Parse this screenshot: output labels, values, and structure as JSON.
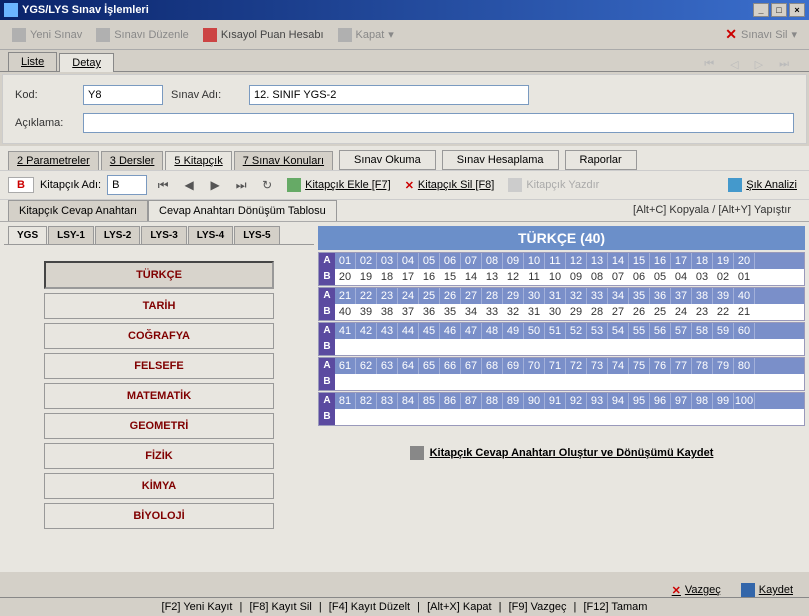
{
  "window": {
    "title": "YGS/LYS Sınav İşlemleri"
  },
  "toolbar": {
    "yeni": "Yeni Sınav",
    "duzenle": "Sınavı Düzenle",
    "kisayol": "Kısayol Puan Hesabı",
    "kapat": "Kapat",
    "sil": "Sınavı Sil"
  },
  "main_tabs": {
    "liste": "Liste",
    "detay": "Detay"
  },
  "form": {
    "kod_label": "Kod:",
    "kod_value": "Y8",
    "sinavadi_label": "Sınav Adı:",
    "sinavadi_value": "12. SINIF YGS-2",
    "aciklama_label": "Açıklama:",
    "aciklama_value": ""
  },
  "sub_tabs": {
    "parametreler": "2 Parametreler",
    "dersler": "3 Dersler",
    "kitapcik": "5 Kitapçık",
    "sinavkonulari": "7 Sınav Konuları",
    "sinavokuma": "Sınav Okuma",
    "sinavhesaplama": "Sınav Hesaplama",
    "raporlar": "Raporlar"
  },
  "kitapcik_bar": {
    "badge": "B",
    "adi_label": "Kitapçık Adı:",
    "adi_value": "B",
    "ekle": "Kitapçık Ekle [F7]",
    "sil": "Kitapçık Sil [F8]",
    "yazdir": "Kitapçık Yazdır",
    "sik": "Şık Analizi"
  },
  "cevap_tabs": {
    "anahtari": "Kitapçık Cevap Anahtarı",
    "donusum": "Cevap Anahtarı Dönüşüm Tablosu",
    "shortcut": "[Alt+C] Kopyala / [Alt+Y] Yapıştır"
  },
  "exam_tabs": [
    "YGS",
    "LSY-1",
    "LYS-2",
    "LYS-3",
    "LYS-4",
    "LYS-5"
  ],
  "subjects": [
    "TÜRKÇE",
    "TARİH",
    "COĞRAFYA",
    "FELSEFE",
    "MATEMATİK",
    "GEOMETRİ",
    "FİZİK",
    "KİMYA",
    "BİYOLOJİ"
  ],
  "active_subject": "TÜRKÇE",
  "subject_header": "TÜRKÇE (40)",
  "grid": [
    {
      "a": [
        "01",
        "02",
        "03",
        "04",
        "05",
        "06",
        "07",
        "08",
        "09",
        "10",
        "11",
        "12",
        "13",
        "14",
        "15",
        "16",
        "17",
        "18",
        "19",
        "20"
      ],
      "b": [
        "20",
        "19",
        "18",
        "17",
        "16",
        "15",
        "14",
        "13",
        "12",
        "11",
        "10",
        "09",
        "08",
        "07",
        "06",
        "05",
        "04",
        "03",
        "02",
        "01"
      ]
    },
    {
      "a": [
        "21",
        "22",
        "23",
        "24",
        "25",
        "26",
        "27",
        "28",
        "29",
        "30",
        "31",
        "32",
        "33",
        "34",
        "35",
        "36",
        "37",
        "38",
        "39",
        "40"
      ],
      "b": [
        "40",
        "39",
        "38",
        "37",
        "36",
        "35",
        "34",
        "33",
        "32",
        "31",
        "30",
        "29",
        "28",
        "27",
        "26",
        "25",
        "24",
        "23",
        "22",
        "21"
      ]
    },
    {
      "a": [
        "41",
        "42",
        "43",
        "44",
        "45",
        "46",
        "47",
        "48",
        "49",
        "50",
        "51",
        "52",
        "53",
        "54",
        "55",
        "56",
        "57",
        "58",
        "59",
        "60"
      ],
      "b": []
    },
    {
      "a": [
        "61",
        "62",
        "63",
        "64",
        "65",
        "66",
        "67",
        "68",
        "69",
        "70",
        "71",
        "72",
        "73",
        "74",
        "75",
        "76",
        "77",
        "78",
        "79",
        "80"
      ],
      "b": []
    },
    {
      "a": [
        "81",
        "82",
        "83",
        "84",
        "85",
        "86",
        "87",
        "88",
        "89",
        "90",
        "91",
        "92",
        "93",
        "94",
        "95",
        "96",
        "97",
        "98",
        "99",
        "100"
      ],
      "b": []
    }
  ],
  "create_btn": "Kitapçık Cevap Anahtarı Oluştur ve Dönüşümü Kaydet",
  "bottom": {
    "vazgec": "Vazgeç",
    "kaydet": "Kaydet"
  },
  "status": {
    "f2": "[F2] Yeni Kayıt",
    "f8": "[F8] Kayıt Sil",
    "f4": "[F4] Kayıt Düzelt",
    "altx": "[Alt+X] Kapat",
    "f9": "[F9] Vazgeç",
    "f12": "[F12] Tamam"
  }
}
